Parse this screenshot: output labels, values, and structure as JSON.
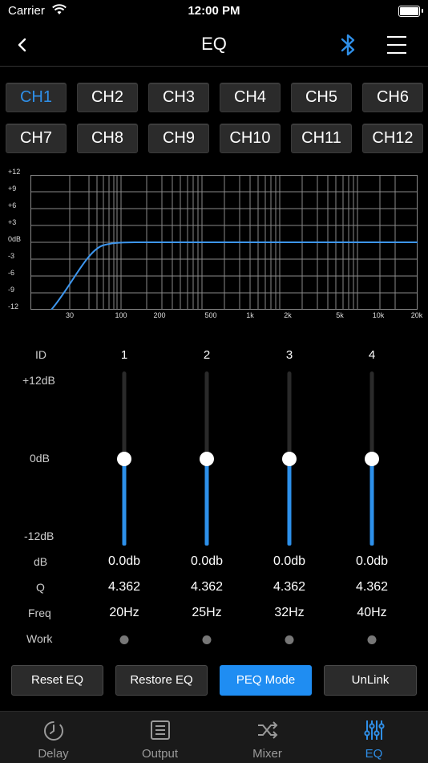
{
  "status": {
    "carrier": "Carrier",
    "time": "12:00 PM"
  },
  "nav": {
    "title": "EQ"
  },
  "channels": [
    "CH1",
    "CH2",
    "CH3",
    "CH4",
    "CH5",
    "CH6",
    "CH7",
    "CH8",
    "CH9",
    "CH10",
    "CH11",
    "CH12"
  ],
  "active_channel": "CH1",
  "graph": {
    "y_labels": [
      "+12",
      "+9",
      "+6",
      "+3",
      "0dB",
      "-3",
      "-6",
      "-9",
      "-12"
    ],
    "x_labels": [
      "30",
      "100",
      "200",
      "500",
      "1k",
      "2k",
      "5k",
      "10k",
      "20k"
    ]
  },
  "eq": {
    "row_labels": {
      "id": "ID",
      "plus": "+12dB",
      "zero": "0dB",
      "minus": "-12dB",
      "db": "dB",
      "q": "Q",
      "freq": "Freq",
      "work": "Work"
    },
    "bands": [
      {
        "id": "1",
        "db": "0.0db",
        "q": "4.362",
        "freq": "20Hz",
        "level": 0.5
      },
      {
        "id": "2",
        "db": "0.0db",
        "q": "4.362",
        "freq": "25Hz",
        "level": 0.5
      },
      {
        "id": "3",
        "db": "0.0db",
        "q": "4.362",
        "freq": "32Hz",
        "level": 0.5
      },
      {
        "id": "4",
        "db": "0.0db",
        "q": "4.362",
        "freq": "40Hz",
        "level": 0.5
      }
    ]
  },
  "buttons": {
    "reset": "Reset EQ",
    "restore": "Restore EQ",
    "peq": "PEQ Mode",
    "unlink": "UnLink"
  },
  "tabs": [
    "Delay",
    "Output",
    "Mixer",
    "EQ"
  ],
  "active_tab": "EQ",
  "colors": {
    "accent": "#2f8fe8",
    "background": "#000000",
    "button": "#2b2b2b"
  }
}
